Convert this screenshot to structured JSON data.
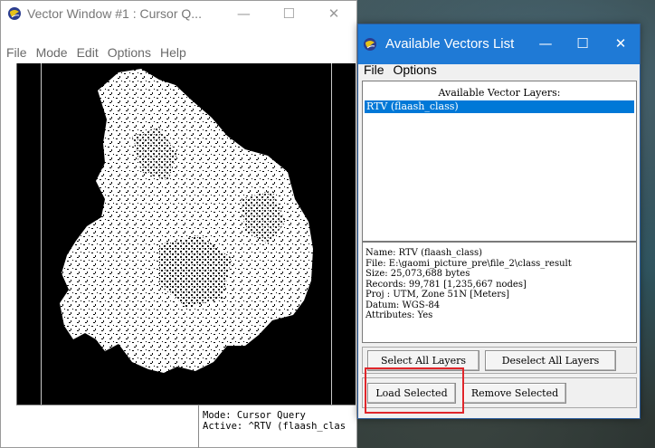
{
  "vector_window": {
    "title": "Vector Window #1 : Cursor Q...",
    "controls": {
      "minimize": "—",
      "maximize": "☐",
      "close": "✕"
    },
    "menu": [
      "File",
      "Mode",
      "Edit",
      "Options",
      "Help"
    ],
    "status_mode": "Mode: Cursor Query",
    "status_active": "Active: ^RTV (flaash_clas"
  },
  "avl_window": {
    "title": "Available Vectors List",
    "controls": {
      "minimize": "—",
      "maximize": "☐",
      "close": "✕"
    },
    "menu": [
      "File",
      "Options"
    ],
    "layers_header": "Available Vector Layers:",
    "layers": [
      "RTV (flaash_class)"
    ],
    "info": {
      "name": "Name: RTV (flaash_class)",
      "file": "File: E:\\gaomi_picture_pre\\file_2\\class_result",
      "size": "Size: 25,073,688 bytes",
      "records": "Records: 99,781 [1,235,667 nodes]",
      "proj": "Proj : UTM, Zone 51N [Meters]",
      "datum": "Datum: WGS-84",
      "attributes": "Attributes: Yes"
    },
    "buttons": {
      "select_all": "Select All Layers",
      "deselect_all": "Deselect All Layers",
      "load_selected": "Load Selected",
      "remove_selected": "Remove Selected"
    }
  },
  "colors": {
    "title_blue": "#1f7ad6",
    "selection_blue": "#0078d7",
    "highlight_red": "#e0262b"
  }
}
